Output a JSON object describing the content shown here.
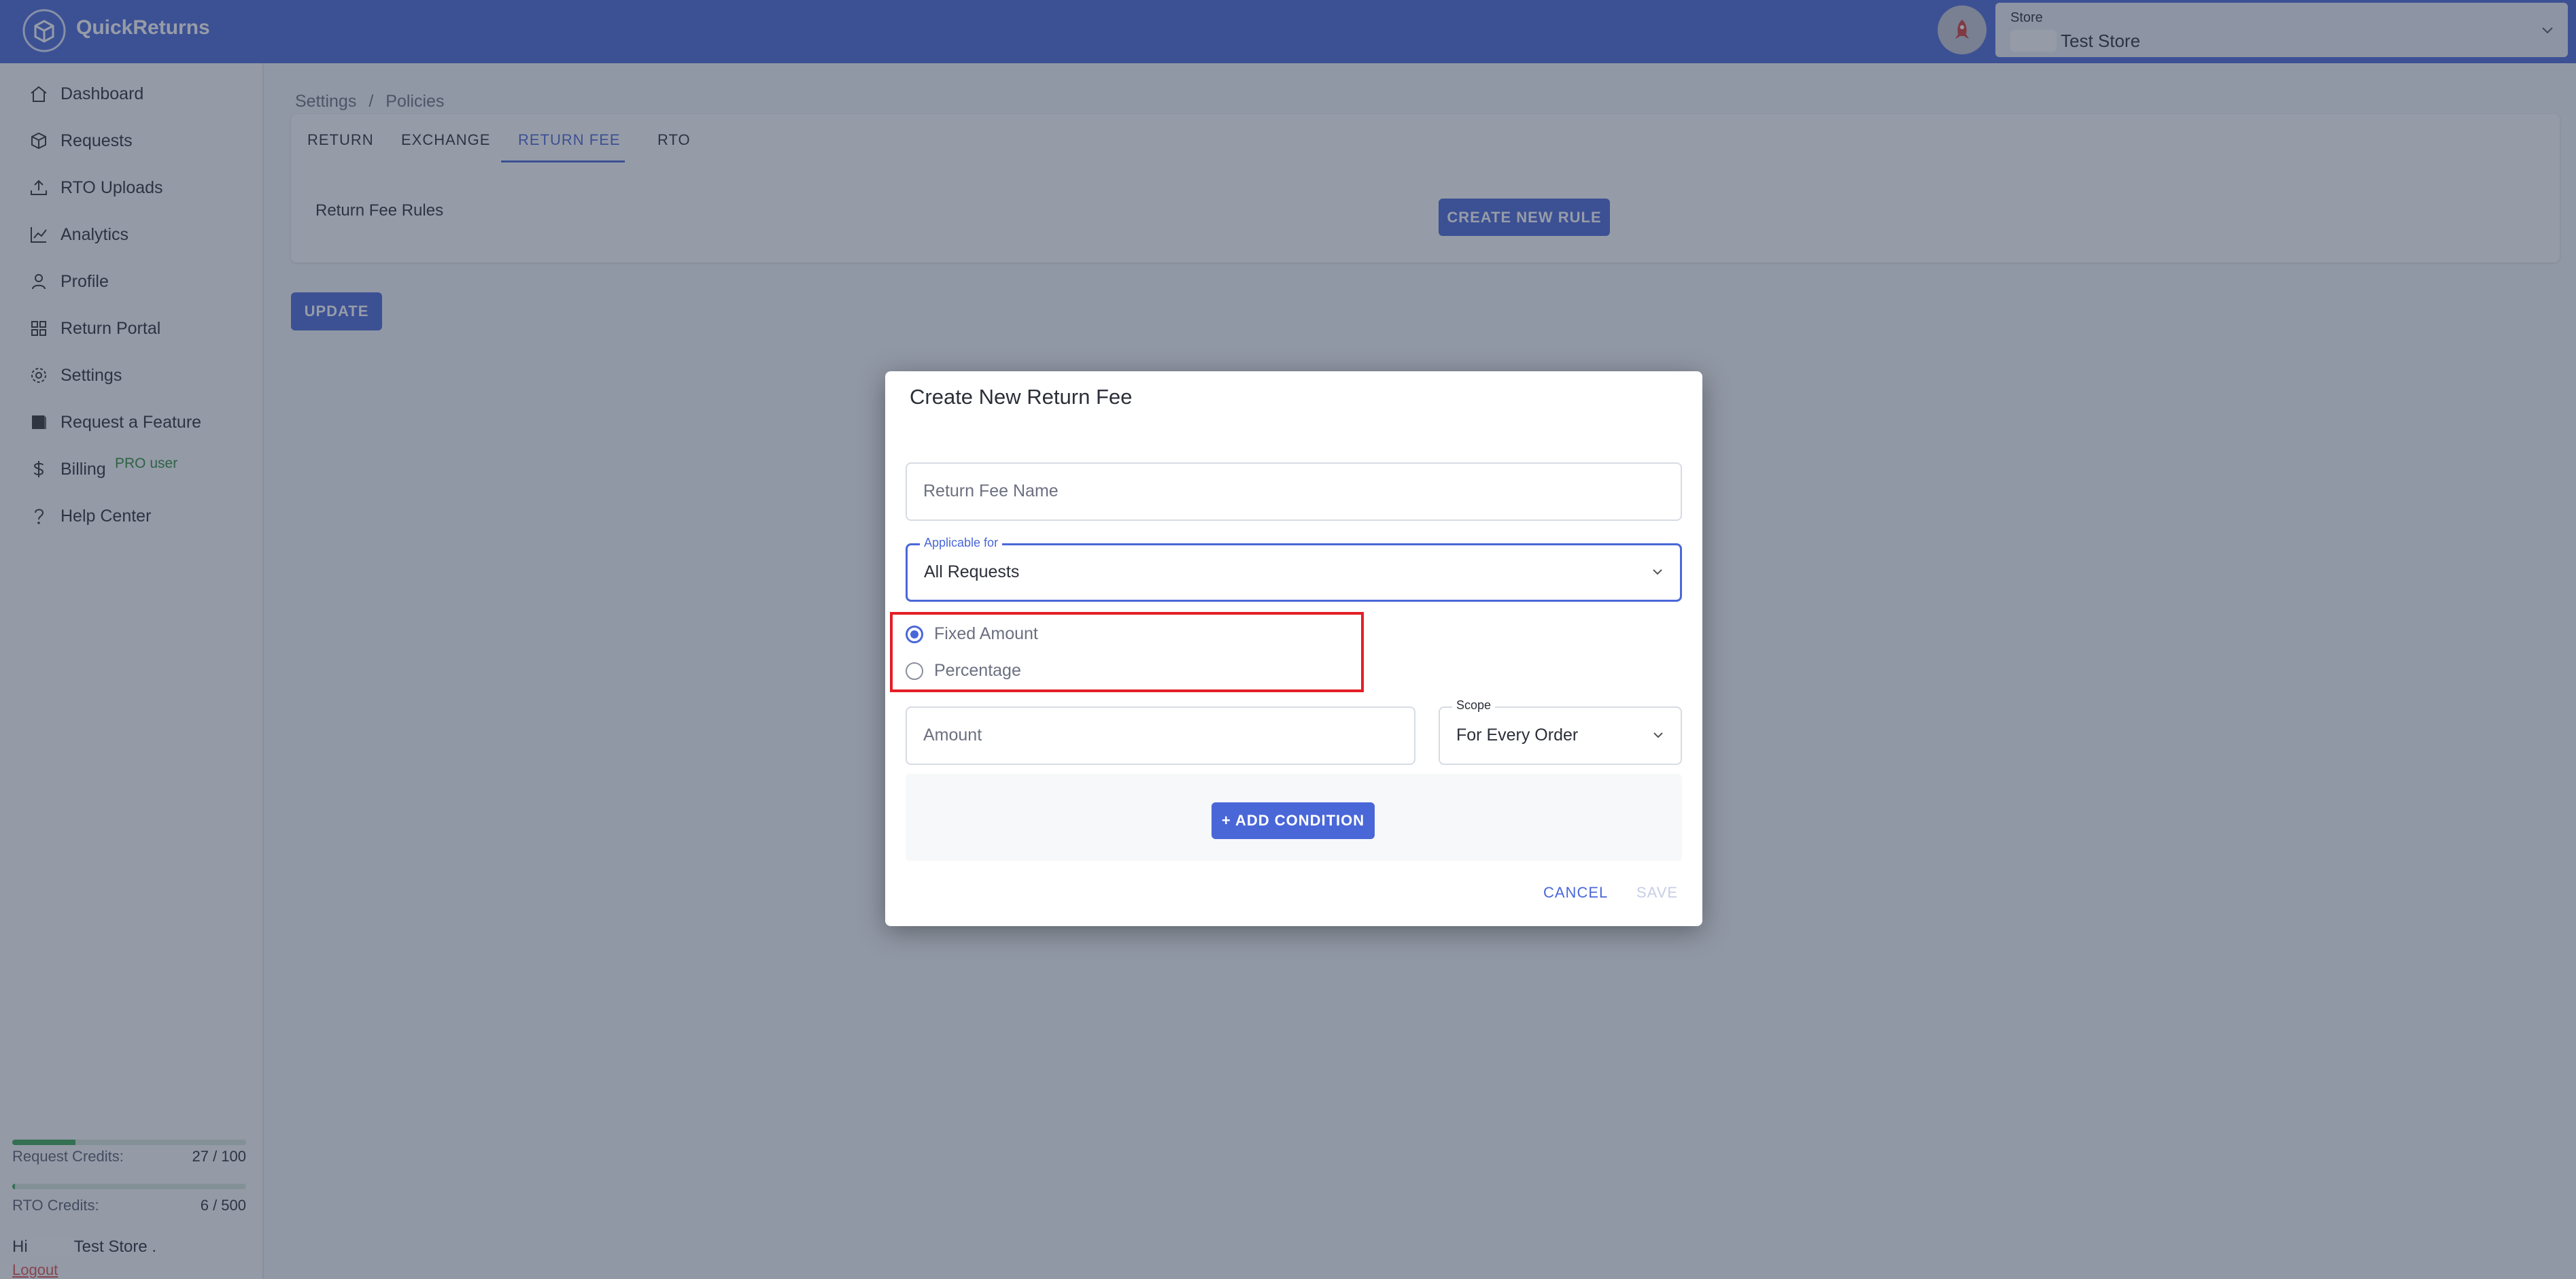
{
  "app": {
    "brand": "QuickReturns"
  },
  "store_selector": {
    "label": "Store",
    "value": "Test Store"
  },
  "sidebar": {
    "items": [
      {
        "label": "Dashboard",
        "icon": "home-icon"
      },
      {
        "label": "Requests",
        "icon": "box-icon"
      },
      {
        "label": "RTO Uploads",
        "icon": "upload-icon"
      },
      {
        "label": "Analytics",
        "icon": "chart-icon"
      },
      {
        "label": "Profile",
        "icon": "user-icon"
      },
      {
        "label": "Return Portal",
        "icon": "grid-icon"
      },
      {
        "label": "Settings",
        "icon": "gear-icon"
      },
      {
        "label": "Request a Feature",
        "icon": "feature-icon"
      },
      {
        "label": "Billing",
        "icon": "dollar-icon",
        "badge": "PRO user"
      },
      {
        "label": "Help Center",
        "icon": "question-icon"
      }
    ],
    "request_credits": {
      "label": "Request Credits:",
      "value": "27 / 100",
      "fraction": 0.27
    },
    "rto_credits": {
      "label": "RTO Credits:",
      "value": "6 / 500",
      "fraction": 0.012
    },
    "greeting_prefix": "Hi",
    "greeting_name": "Test Store .",
    "logout": "Logout"
  },
  "breadcrumb": {
    "items": [
      "Settings",
      "Policies"
    ],
    "separator": "/"
  },
  "tabs": [
    {
      "label": "RETURN"
    },
    {
      "label": "EXCHANGE"
    },
    {
      "label": "RETURN FEE",
      "active": true
    },
    {
      "label": "RTO"
    }
  ],
  "return_fee": {
    "rules_label": "Return Fee Rules",
    "create_button": "CREATE NEW RULE"
  },
  "update_button": "UPDATE",
  "dialog": {
    "title": "Create New Return Fee",
    "name_placeholder": "Return Fee Name",
    "applicable_label": "Applicable for",
    "applicable_value": "All Requests",
    "fee_types": [
      {
        "label": "Fixed Amount",
        "checked": true
      },
      {
        "label": "Percentage",
        "checked": false
      }
    ],
    "amount_placeholder": "Amount",
    "scope_label": "Scope",
    "scope_value": "For Every Order",
    "add_condition": "+ ADD CONDITION",
    "cancel": "CANCEL",
    "save": "SAVE"
  },
  "colors": {
    "primary": "#4a67d8",
    "highlight": "#e41e26",
    "pro": "#2e8b3c",
    "logout": "#e05050"
  }
}
